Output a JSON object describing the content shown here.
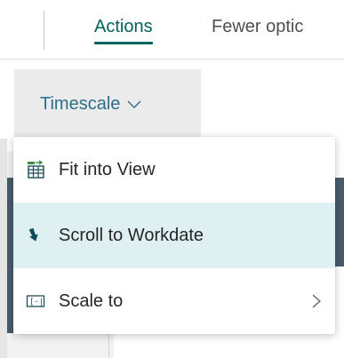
{
  "tabs": {
    "actions_label": "Actions",
    "fewer_label": "Fewer optic"
  },
  "timescale": {
    "label": "Timescale",
    "icon": "chevron-down-icon"
  },
  "menu": {
    "items": [
      {
        "label": "Fit into View",
        "icon": "fit-view-icon",
        "highlighted": false
      },
      {
        "label": "Scroll to Workdate",
        "icon": "scroll-arrow-icon",
        "highlighted": true
      },
      {
        "label": "Scale to",
        "icon": "scale-icon",
        "has_submenu": true,
        "highlighted": false
      }
    ]
  },
  "colors": {
    "accent": "#00635d",
    "link": "#2b6f88",
    "hover": "#def0f2",
    "dark_bar": "#475c6c"
  }
}
